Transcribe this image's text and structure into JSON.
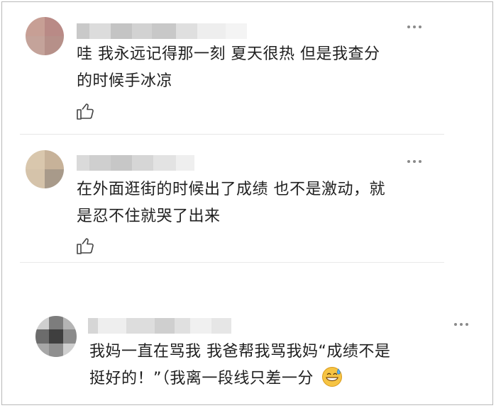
{
  "comments": [
    {
      "text_line1": "哇 我永远记得那一刻 夏天很热 但是我查分",
      "text_line2": "的时候手冰凉"
    },
    {
      "text_line1": "在外面逛街的时候出了成绩 也不是激动，就",
      "text_line2": "是忍不住就哭了出来"
    },
    {
      "text_line1": "我妈一直在骂我 我爸帮我骂我妈“成绩不是",
      "text_line2": "挺好的！”（我离一段线只差一分"
    }
  ],
  "icons": {
    "more": "more-dots-icon",
    "like": "thumbs-up-icon",
    "emoji": "grinning-sweat-emoji"
  },
  "colors": {
    "text": "#1f1f1f",
    "icon": "#8a8a8a",
    "divider": "#e6e6e6",
    "border": "#b9b9b9"
  }
}
